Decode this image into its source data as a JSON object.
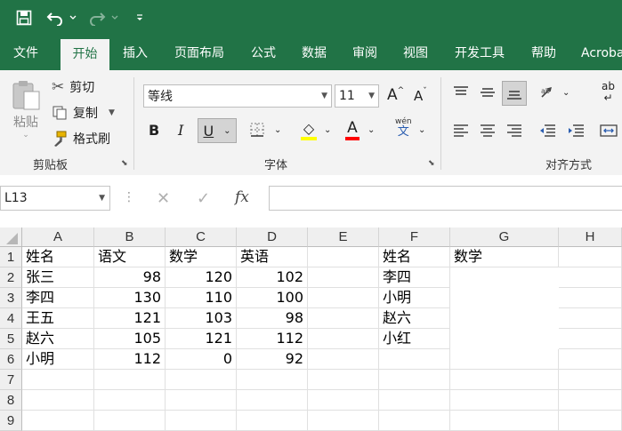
{
  "ribbon_tabs": [
    "文件",
    "开始",
    "插入",
    "页面布局",
    "公式",
    "数据",
    "审阅",
    "视图",
    "开发工具",
    "帮助",
    "Acrobat"
  ],
  "active_tab": "开始",
  "clipboard": {
    "paste_label": "粘贴",
    "cut_label": "剪切",
    "copy_label": "复制",
    "format_painter_label": "格式刷",
    "group_label": "剪贴板"
  },
  "font": {
    "font_name": "等线",
    "font_size": "11",
    "bold": "B",
    "italic": "I",
    "underline": "U",
    "font_color_letter": "A",
    "phonetic_top": "wén",
    "phonetic_bottom": "文",
    "grow": "A",
    "shrink": "A",
    "group_label": "字体"
  },
  "alignment": {
    "group_label": "对齐方式",
    "wrap_label": "ab"
  },
  "formula_bar": {
    "name_box": "L13",
    "fx": "fx",
    "formula": ""
  },
  "columns": [
    "A",
    "B",
    "C",
    "D",
    "E",
    "F",
    "G",
    "H"
  ],
  "rows": [
    "1",
    "2",
    "3",
    "4",
    "5",
    "6",
    "7",
    "8",
    "9"
  ],
  "cells": {
    "r1": [
      "姓名",
      "语文",
      "数学",
      "英语",
      "",
      "姓名",
      "数学",
      ""
    ],
    "r2": [
      "张三",
      "98",
      "120",
      "102",
      "",
      "李四",
      "",
      ""
    ],
    "r3": [
      "李四",
      "130",
      "110",
      "100",
      "",
      "小明",
      "",
      ""
    ],
    "r4": [
      "王五",
      "121",
      "103",
      "98",
      "",
      "赵六",
      "",
      ""
    ],
    "r5": [
      "赵六",
      "105",
      "121",
      "112",
      "",
      "小红",
      "",
      ""
    ],
    "r6": [
      "小明",
      "112",
      "0",
      "92",
      "",
      "",
      "",
      ""
    ],
    "r7": [
      "",
      "",
      "",
      "",
      "",
      "",
      "",
      ""
    ],
    "r8": [
      "",
      "",
      "",
      "",
      "",
      "",
      "",
      ""
    ],
    "r9": [
      "",
      "",
      "",
      "",
      "",
      "",
      "",
      ""
    ]
  },
  "colors": {
    "excel_green": "#217346",
    "ribbon_bg": "#f3f3f3",
    "grid_line": "#e0e0e0"
  }
}
